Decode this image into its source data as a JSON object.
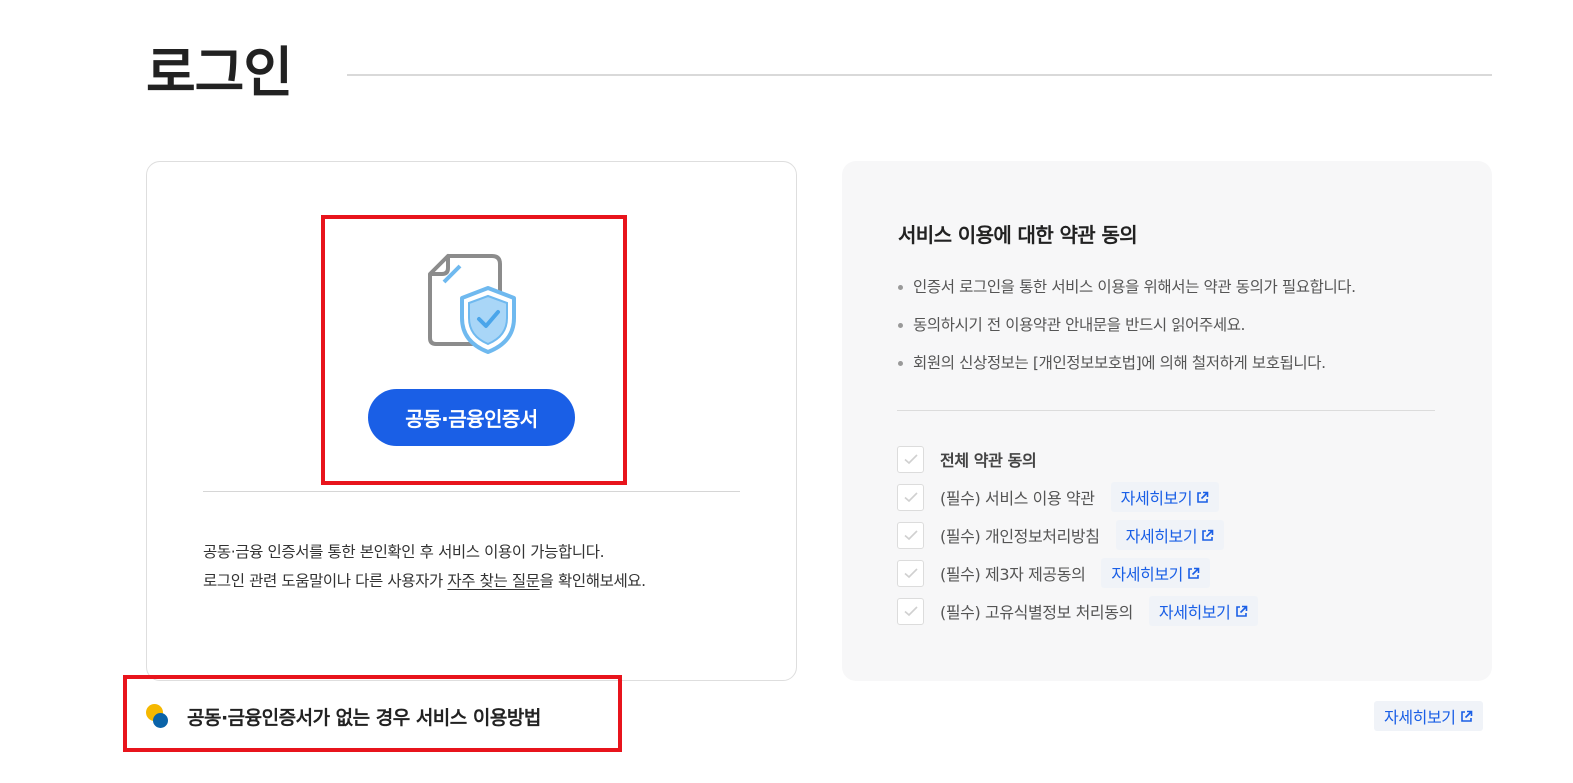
{
  "page": {
    "title": "로그인"
  },
  "login_card": {
    "icon": "certificate-shield-icon",
    "button_label": "공동·금융인증서",
    "desc_line1": "공동·금융 인증서를 통한 본인확인 후 서비스 이용이 가능합니다.",
    "desc_line2_prefix": "로그인 관련 도움말이나 다른 사용자가 ",
    "desc_line2_link": "자주 찾는 질문",
    "desc_line2_suffix": "을 확인해보세요."
  },
  "terms": {
    "title": "서비스 이용에 대한 약관 동의",
    "notices": [
      "인증서 로그인을 통한 서비스 이용을 위해서는 약관 동의가 필요합니다.",
      "동의하시기 전 이용약관 안내문을 반드시 읽어주세요.",
      "회원의 신상정보는 [개인정보보호법]에 의해 철저하게 보호됩니다."
    ],
    "agree_all": "전체 약관 동의",
    "items": [
      {
        "label": "(필수) 서비스 이용 약관",
        "link": "자세히보기"
      },
      {
        "label": "(필수) 개인정보처리방침",
        "link": "자세히보기"
      },
      {
        "label": "(필수) 제3자 제공동의",
        "link": "자세히보기"
      },
      {
        "label": "(필수) 고유식별정보 처리동의",
        "link": "자세히보기"
      }
    ]
  },
  "bottom": {
    "no_cert_title": "공동·금융인증서가 없는 경우 서비스 이용방법",
    "detail_link": "자세히보기"
  },
  "colors": {
    "primary": "#1a5fe6",
    "highlight": "#e8141c",
    "panel_bg": "#f7f7f8"
  }
}
